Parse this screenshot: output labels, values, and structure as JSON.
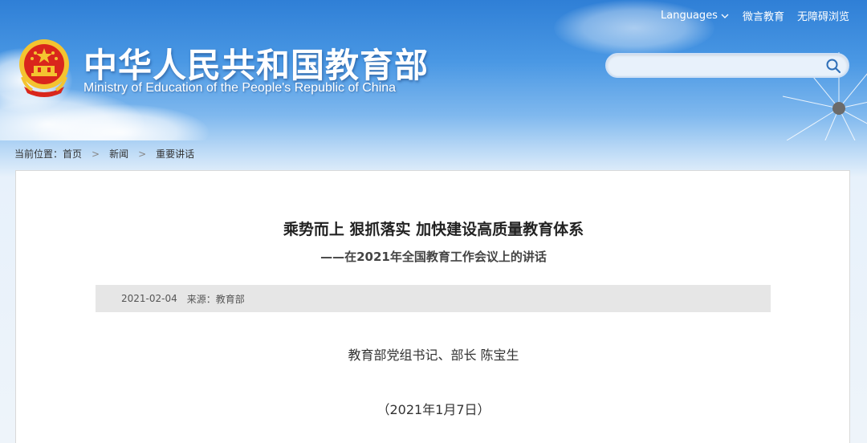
{
  "header": {
    "logo_cn": "中华人民共和国教育部",
    "logo_en": "Ministry of Education of the People's Republic of China",
    "top_links": {
      "languages": "Languages",
      "weiyan": "微言教育",
      "accessible": "无障碍浏览"
    },
    "search": {
      "placeholder": "",
      "value": ""
    }
  },
  "breadcrumb": {
    "prefix": "当前位置：",
    "items": [
      "首页",
      "新闻",
      "重要讲话"
    ],
    "separator": ">"
  },
  "article": {
    "title": "乘势而上 狠抓落实 加快建设高质量教育体系",
    "subtitle": "——在2021年全国教育工作会议上的讲话",
    "meta": {
      "date": "2021-02-04",
      "source": "来源：教育部"
    },
    "author": "教育部党组书记、部长 陈宝生",
    "date_line": "（2021年1月7日）"
  },
  "colors": {
    "header_blue": "#2f7fd6",
    "emblem_red": "#d9261c",
    "emblem_gold": "#f4c430",
    "meta_bar": "#e6e6e6"
  }
}
